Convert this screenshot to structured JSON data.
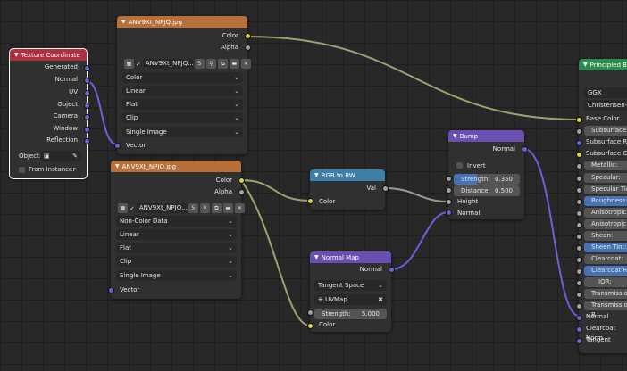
{
  "tex_coord": {
    "title": "Texture Coordinate",
    "outputs": [
      "Generated",
      "Normal",
      "UV",
      "Object",
      "Camera",
      "Window",
      "Reflection"
    ],
    "object_label": "Object:",
    "from_instancer": "From Instancer"
  },
  "image1": {
    "title": "ANV9Xt_NPJQ.jpg",
    "outputs": [
      "Color",
      "Alpha"
    ],
    "image_name": "ANV9Xt_NPJQ...",
    "users": "5",
    "color_space": "Color",
    "interpolation": "Linear",
    "projection": "Flat",
    "extension": "Clip",
    "source": "Single Image",
    "input": "Vector"
  },
  "image2": {
    "title": "ANV9Xt_NPJQ.jpg",
    "outputs": [
      "Color",
      "Alpha"
    ],
    "image_name": "ANV9Xt_NPJQ...",
    "users": "5",
    "color_space": "Non-Color Data",
    "interpolation": "Linear",
    "projection": "Flat",
    "extension": "Clip",
    "source": "Single Image",
    "input": "Vector"
  },
  "rgb_bw": {
    "title": "RGB to BW",
    "output": "Val",
    "input": "Color"
  },
  "normal_map": {
    "title": "Normal Map",
    "output": "Normal",
    "space": "Tangent Space",
    "uv_map": "UVMap",
    "strength_label": "Strength:",
    "strength_value": "5.000",
    "input": "Color"
  },
  "bump": {
    "title": "Bump",
    "output": "Normal",
    "invert": "Invert",
    "strength_label": "Strength:",
    "strength_value": "0.350",
    "strength_fraction": 0.35,
    "distance_label": "Distance:",
    "distance_value": "0.500",
    "inputs": [
      "Height",
      "Normal"
    ]
  },
  "principled": {
    "title": "Principled BSD",
    "distribution": "GGX",
    "subsurface_method": "Christensen-Bu",
    "inputs": [
      "Base Color",
      "Subsurface:",
      "Subsurface Ra",
      "Subsurface Co",
      "Metallic:",
      "Specular:",
      "Specular Tint:",
      "Roughness:",
      "Anisotropic:",
      "Anisotropic Ro",
      "Sheen:",
      "Sheen Tint:",
      "Clearcoat:",
      "Clearcoat Rou",
      "IOR:",
      "Transmission:",
      "Transmission R",
      "Normal",
      "Clearcoat Norm",
      "Tangent"
    ]
  }
}
